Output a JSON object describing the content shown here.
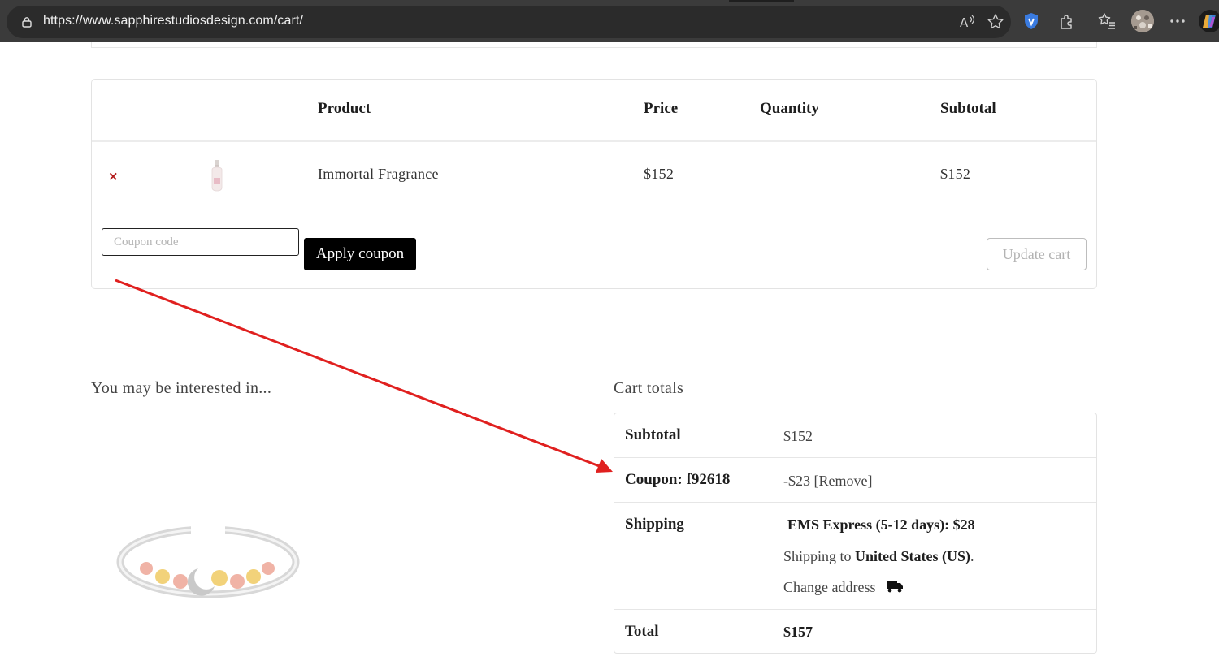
{
  "browser": {
    "url": "https://www.sapphirestudiosdesign.com/cart/",
    "icons": [
      "lock-icon",
      "read-aloud-icon",
      "favorite-star-icon",
      "shield-extension-icon",
      "extensions-icon",
      "favorites-icon",
      "profile-avatar",
      "more-menu-icon",
      "copilot-icon"
    ]
  },
  "cart": {
    "headers": {
      "product": "Product",
      "price": "Price",
      "quantity": "Quantity",
      "subtotal": "Subtotal"
    },
    "item": {
      "remove": "×",
      "name": "Immortal Fragrance",
      "price": "$152",
      "subtotal": "$152"
    },
    "coupon_placeholder": "Coupon code",
    "apply_label": "Apply coupon",
    "update_label": "Update cart"
  },
  "related": {
    "title": "You may be interested in..."
  },
  "totals": {
    "title": "Cart totals",
    "subtotal_label": "Subtotal",
    "subtotal_value": "$152",
    "coupon_label": "Coupon: f92618",
    "coupon_value": "-$23",
    "coupon_remove": "[Remove]",
    "shipping_label": "Shipping",
    "shipping_method": "EMS Express (5-12 days): $28",
    "shipping_to_prefix": "Shipping to",
    "shipping_to_country": "United States (US)",
    "shipping_to_suffix": ".",
    "change_address": "Change address",
    "total_label": "Total",
    "total_value": "$157"
  },
  "colors": {
    "annotation_arrow": "#e0201f",
    "remove_x": "#b31a1a",
    "button_dark": "#000000"
  }
}
